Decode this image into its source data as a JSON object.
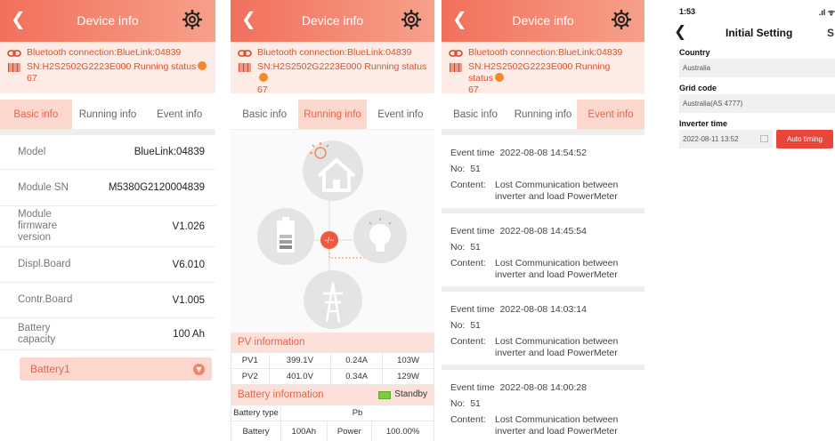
{
  "device_info": {
    "title": "Device info",
    "bluetooth": "Bluetooth connection:BlueLink:04839",
    "sn_status": "SN:H2S2502G2223E000   Running status",
    "status_code": "67",
    "tabs": [
      "Basic info",
      "Running info",
      "Event info"
    ]
  },
  "basic": {
    "rows": [
      {
        "label": "Model",
        "value": "BlueLink:04839"
      },
      {
        "label": "Module SN",
        "value": "M5380G2120004839"
      },
      {
        "label": "Module firmware version",
        "value": "V1.026"
      },
      {
        "label": "Displ.Board",
        "value": "V6.010"
      },
      {
        "label": "Contr.Board",
        "value": "V1.005"
      },
      {
        "label": "Battery capacity",
        "value": "100 Ah"
      }
    ],
    "battery1": "Battery1"
  },
  "running": {
    "pv_title": "PV information",
    "pv_rows": [
      [
        "PV1",
        "399.1V",
        "0.24A",
        "103W"
      ],
      [
        "PV2",
        "401.0V",
        "0.34A",
        "129W"
      ]
    ],
    "battery_title": "Battery information",
    "battery_status": "Standby",
    "battery_type_label": "Battery type",
    "battery_type": "Pb",
    "battery_label": "Battery",
    "battery_value": "100Ah",
    "power_label": "Power",
    "power_value": "100.00%"
  },
  "events": [
    {
      "time_label": "Event time",
      "time": "2022-08-08 14:54:52",
      "no_label": "No:",
      "no": "51",
      "content_label": "Content:",
      "content": "Lost Communication between inverter and load PowerMeter"
    },
    {
      "time_label": "Event time",
      "time": "2022-08-08 14:45:54",
      "no_label": "No:",
      "no": "51",
      "content_label": "Content:",
      "content": "Lost Communication between inverter and load PowerMeter"
    },
    {
      "time_label": "Event time",
      "time": "2022-08-08 14:03:14",
      "no_label": "No:",
      "no": "51",
      "content_label": "Content:",
      "content": "Lost Communication between inverter and load PowerMeter"
    },
    {
      "time_label": "Event time",
      "time": "2022-08-08 14:00:28",
      "no_label": "No:",
      "no": "51",
      "content_label": "Content:",
      "content": "Lost Communication between inverter and load PowerMeter"
    }
  ],
  "initial_setting": {
    "status_time": "1:53",
    "title": "Initial Setting",
    "title_right": "S",
    "country_label": "Country",
    "country": "Australia",
    "grid_label": "Grid code",
    "grid": "Australia(AS 4777)",
    "inverter_time_label": "Inverter time",
    "inverter_time": "2022-08-11 13:52",
    "auto_timing": "Auto timing"
  },
  "icons": [
    "back-arrow",
    "gear",
    "chain-link",
    "barcode",
    "sun-house",
    "battery",
    "bulb",
    "grid-tower"
  ],
  "colors": {
    "accent": "#f1705c",
    "tab_active_bg": "#fbd7cd",
    "auto_btn": "#e9453a"
  }
}
